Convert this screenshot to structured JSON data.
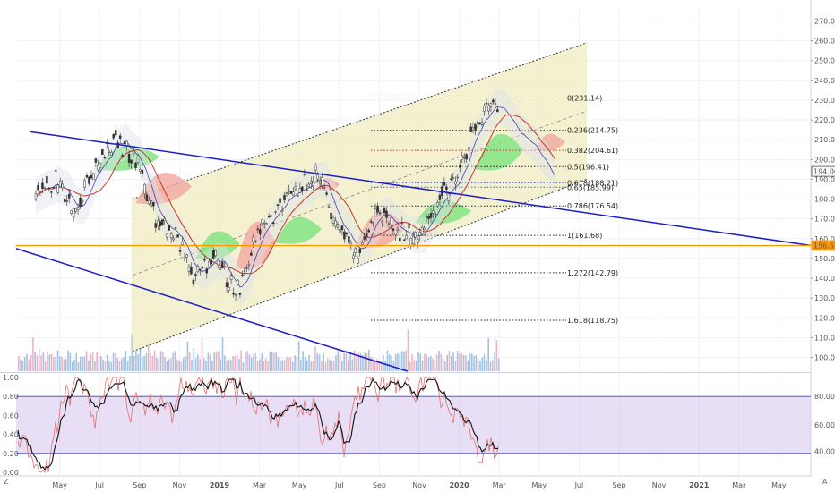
{
  "corner_labels": {
    "bottom_left": "Z",
    "bottom_right": "A"
  },
  "colors": {
    "channel_fill": "#f1efc8",
    "downtrend_line": "#1c1cc8",
    "support_line": "#ff9800",
    "candle": "#333333",
    "ma_red": "#c0392b",
    "ma_blue": "#1a1aa8",
    "cloud_green": "#7ee27e",
    "cloud_red": "#f2a8a0",
    "osc_band": "#d9c8ee",
    "osc_black": "#111111",
    "osc_red": "#e0716b",
    "badge_support": "#ff9800",
    "volume": "#8fb3d9"
  },
  "chart_data": [
    {
      "type": "candlestick",
      "x_ticks": [
        "May",
        "Jul",
        "Sep",
        "Nov",
        "2019",
        "Mar",
        "May",
        "Jul",
        "Sep",
        "Nov",
        "2020",
        "Mar",
        "May",
        "Jul",
        "Sep",
        "Nov",
        "2021",
        "Mar",
        "May"
      ],
      "bold_ticks": [
        "2019",
        "2020",
        "2021"
      ],
      "y_ticks": [
        "270.00",
        "260.00",
        "250.00",
        "240.00",
        "230.00",
        "220.00",
        "210.00",
        "200.00",
        "190.00",
        "180.00",
        "170.00",
        "160.00",
        "150.00",
        "140.00",
        "130.00",
        "120.00",
        "110.00",
        "100.00"
      ],
      "y_range": [
        93,
        277
      ],
      "price_labels": [
        {
          "text": "194.00",
          "value": 194.0,
          "style": "plain"
        },
        {
          "text": "156.52",
          "value": 156.52,
          "style": "support"
        }
      ],
      "horizontal_support": 156.52,
      "fibonacci": [
        {
          "label": "0(231.14)",
          "value": 231.14,
          "color": "#222222"
        },
        {
          "label": "0.236(214.75)",
          "value": 214.75,
          "color": "#222222"
        },
        {
          "label": "0.382(204.61)",
          "value": 204.61,
          "color": "#c0392b"
        },
        {
          "label": "0.5(196.41)",
          "value": 196.41,
          "color": "#222222"
        },
        {
          "label": "0.618(188.21)",
          "value": 188.21,
          "color": "#3b5bdb"
        },
        {
          "label": "0.65(185.99)",
          "value": 185.99,
          "color": "#7b3fb8"
        },
        {
          "label": "0.786(176.54)",
          "value": 176.54,
          "color": "#222222"
        },
        {
          "label": "1(161.68)",
          "value": 161.68,
          "color": "#222222"
        },
        {
          "label": "1.272(142.79)",
          "value": 142.79,
          "color": "#222222"
        },
        {
          "label": "1.618(118.75)",
          "value": 118.75,
          "color": "#222222"
        }
      ],
      "price_series": [
        {
          "date": "2018-03",
          "value": 185
        },
        {
          "date": "2018-04",
          "value": 190
        },
        {
          "date": "2018-05",
          "value": 176
        },
        {
          "date": "2018-06",
          "value": 196
        },
        {
          "date": "2018-07",
          "value": 210
        },
        {
          "date": "2018-08",
          "value": 200
        },
        {
          "date": "2018-09",
          "value": 170
        },
        {
          "date": "2018-10",
          "value": 160
        },
        {
          "date": "2018-11",
          "value": 140
        },
        {
          "date": "2018-12",
          "value": 154
        },
        {
          "date": "2019-01",
          "value": 130
        },
        {
          "date": "2019-02",
          "value": 160
        },
        {
          "date": "2019-03",
          "value": 175
        },
        {
          "date": "2019-04",
          "value": 184
        },
        {
          "date": "2019-05",
          "value": 193
        },
        {
          "date": "2019-06",
          "value": 170
        },
        {
          "date": "2019-07",
          "value": 150
        },
        {
          "date": "2019-08",
          "value": 172
        },
        {
          "date": "2019-09",
          "value": 166
        },
        {
          "date": "2019-10",
          "value": 160
        },
        {
          "date": "2019-11",
          "value": 178
        },
        {
          "date": "2019-12",
          "value": 188
        },
        {
          "date": "2020-01",
          "value": 218
        },
        {
          "date": "2020-02",
          "value": 228
        },
        {
          "date": "2020-03",
          "value": 215
        },
        {
          "date": "2020-04",
          "value": 206
        },
        {
          "date": "2020-05",
          "value": 183
        }
      ]
    },
    {
      "type": "line",
      "name": "oscillator",
      "y_ticks_left": [
        "1.00",
        "0.80",
        "0.60",
        "0.40",
        "0.20",
        "0.00"
      ],
      "y_ticks_right": [
        "80.00",
        "60.00",
        "40.00"
      ],
      "bands": [
        0.2,
        0.8
      ]
    }
  ]
}
